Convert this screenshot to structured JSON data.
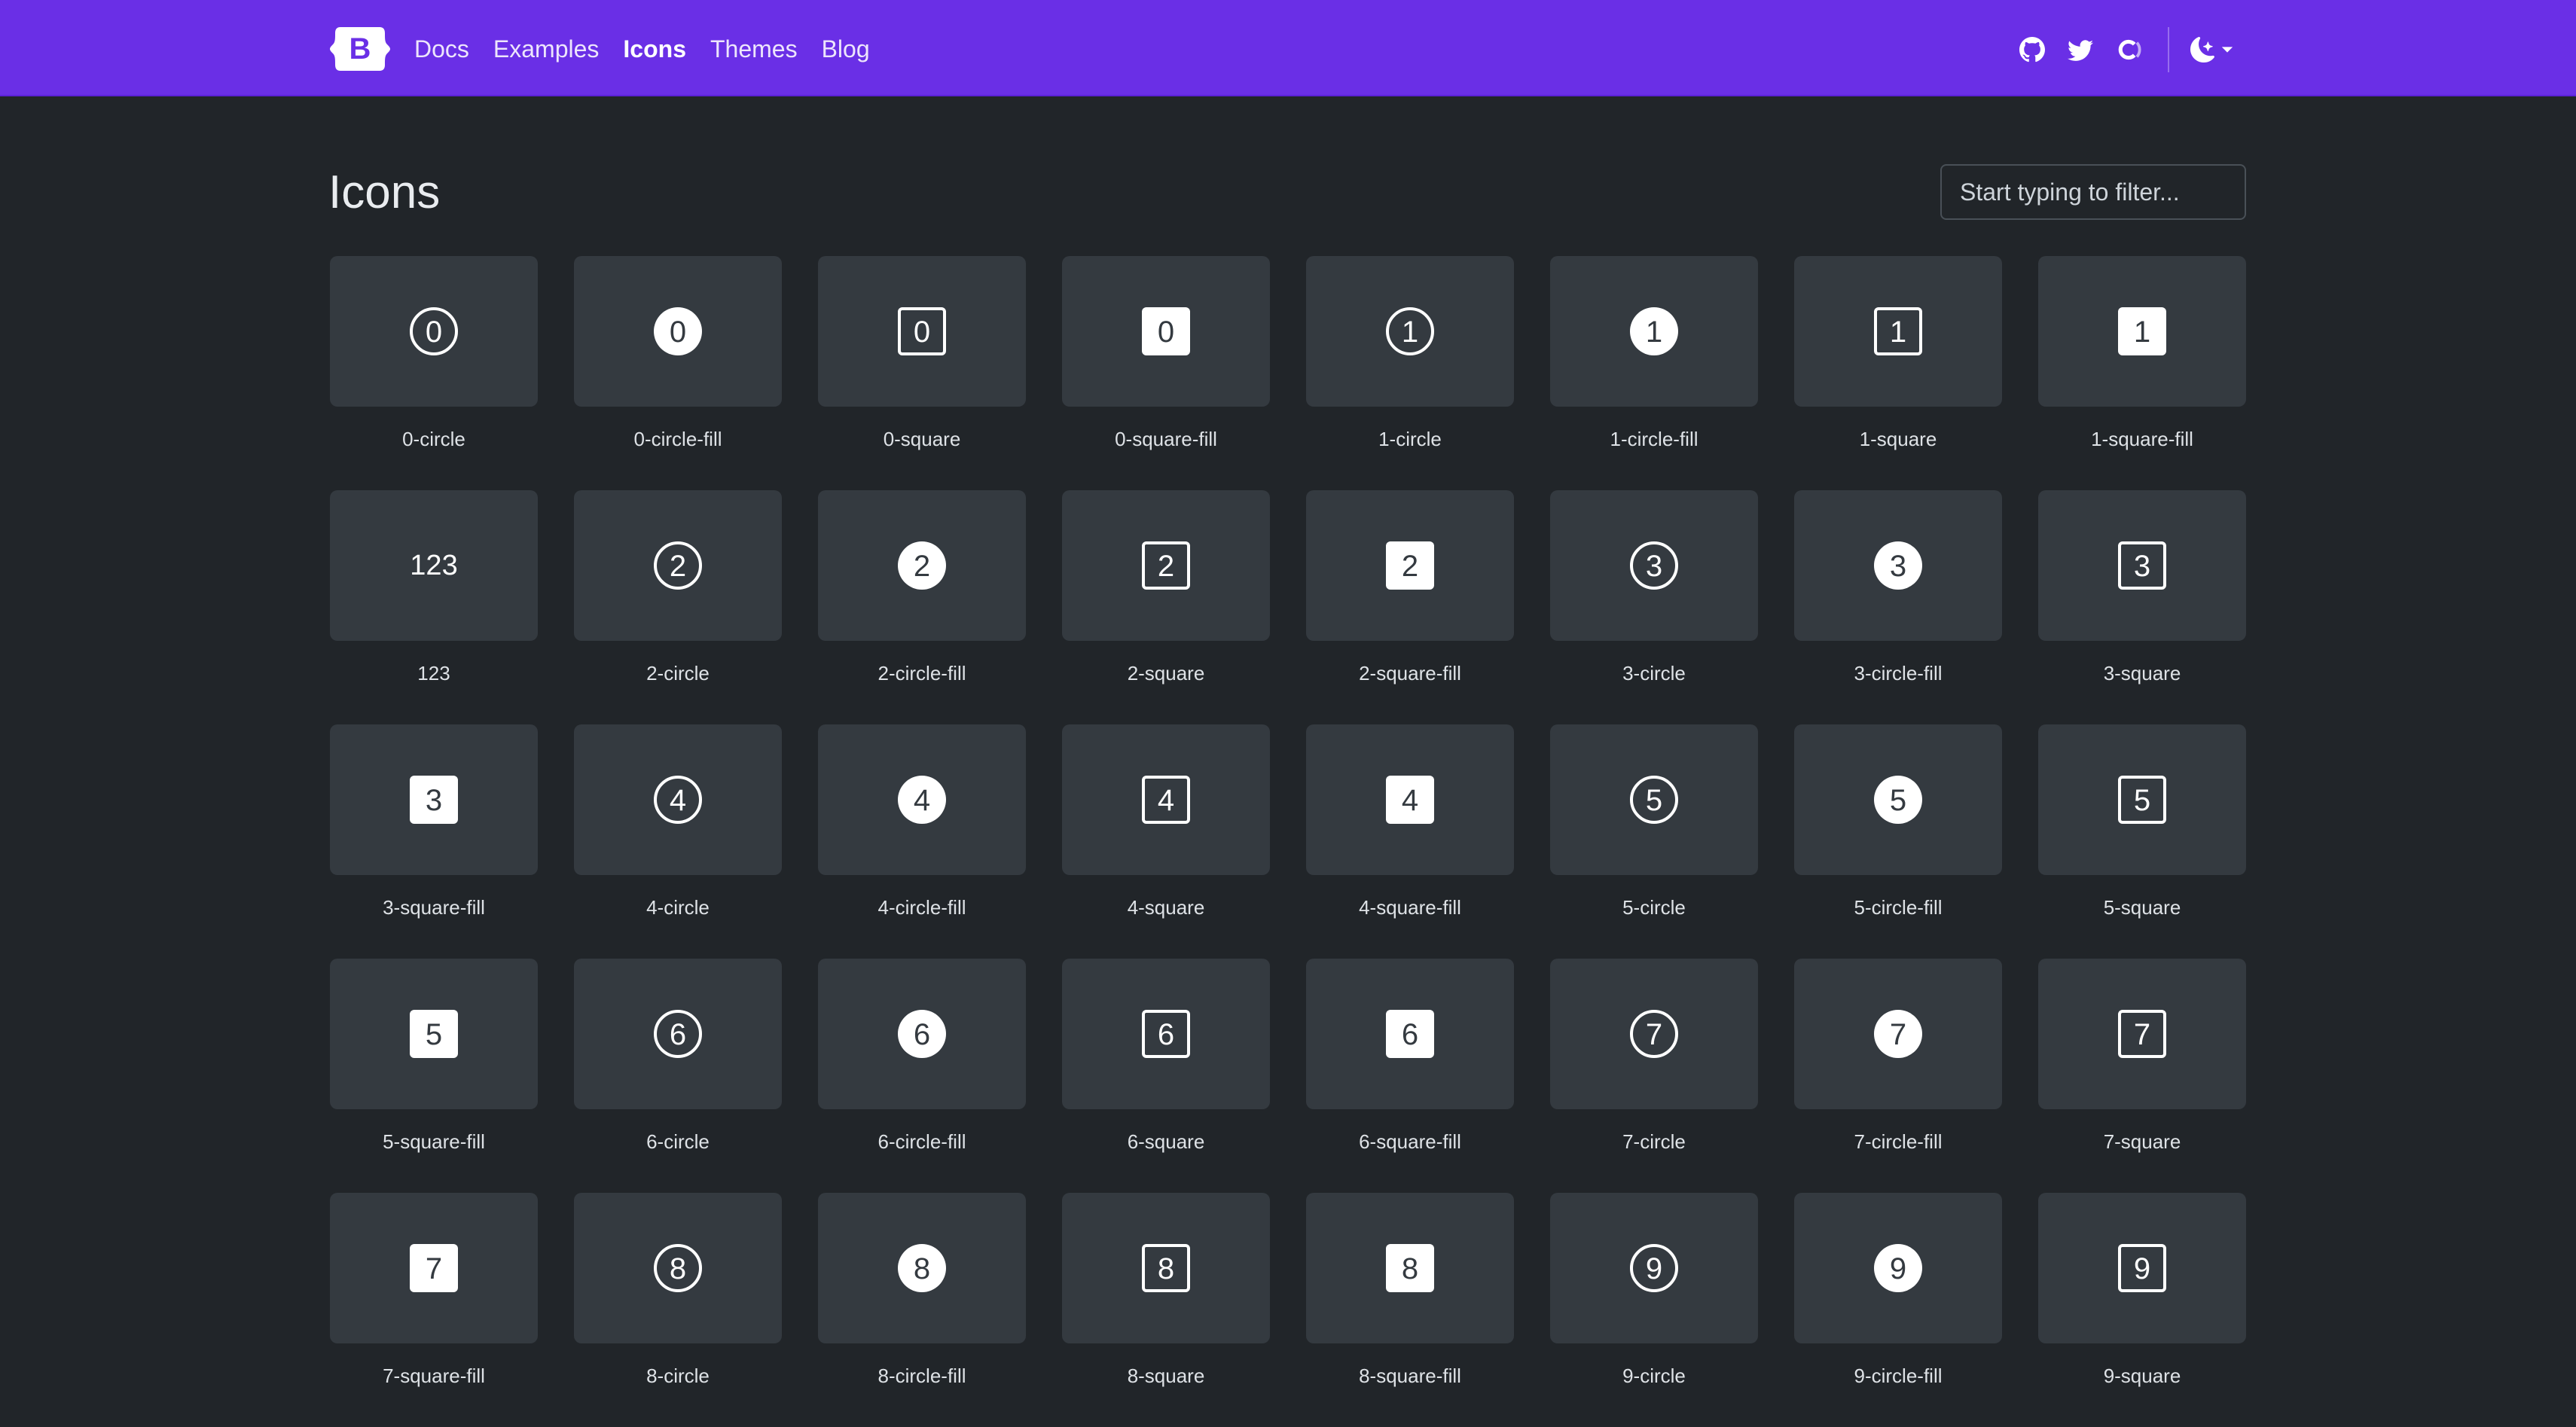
{
  "navbar": {
    "brand_icon": "bootstrap-logo",
    "brand_letter": "B",
    "links": [
      {
        "label": "Docs",
        "active": false
      },
      {
        "label": "Examples",
        "active": false
      },
      {
        "label": "Icons",
        "active": true
      },
      {
        "label": "Themes",
        "active": false
      },
      {
        "label": "Blog",
        "active": false
      }
    ],
    "right_icons": [
      "github-icon",
      "twitter-icon",
      "opencollective-icon"
    ],
    "theme_icon": "moon-stars-icon",
    "color": "#6a2fe6"
  },
  "page": {
    "title": "Icons",
    "filter_placeholder": "Start typing to filter..."
  },
  "icons": [
    {
      "label": "0-circle",
      "digit": "0",
      "style": "circle"
    },
    {
      "label": "0-circle-fill",
      "digit": "0",
      "style": "circle-fill"
    },
    {
      "label": "0-square",
      "digit": "0",
      "style": "square"
    },
    {
      "label": "0-square-fill",
      "digit": "0",
      "style": "square-fill"
    },
    {
      "label": "1-circle",
      "digit": "1",
      "style": "circle"
    },
    {
      "label": "1-circle-fill",
      "digit": "1",
      "style": "circle-fill"
    },
    {
      "label": "1-square",
      "digit": "1",
      "style": "square"
    },
    {
      "label": "1-square-fill",
      "digit": "1",
      "style": "square-fill"
    },
    {
      "label": "123",
      "digit": "123",
      "style": "text"
    },
    {
      "label": "2-circle",
      "digit": "2",
      "style": "circle"
    },
    {
      "label": "2-circle-fill",
      "digit": "2",
      "style": "circle-fill"
    },
    {
      "label": "2-square",
      "digit": "2",
      "style": "square"
    },
    {
      "label": "2-square-fill",
      "digit": "2",
      "style": "square-fill"
    },
    {
      "label": "3-circle",
      "digit": "3",
      "style": "circle"
    },
    {
      "label": "3-circle-fill",
      "digit": "3",
      "style": "circle-fill"
    },
    {
      "label": "3-square",
      "digit": "3",
      "style": "square"
    },
    {
      "label": "3-square-fill",
      "digit": "3",
      "style": "square-fill"
    },
    {
      "label": "4-circle",
      "digit": "4",
      "style": "circle"
    },
    {
      "label": "4-circle-fill",
      "digit": "4",
      "style": "circle-fill"
    },
    {
      "label": "4-square",
      "digit": "4",
      "style": "square"
    },
    {
      "label": "4-square-fill",
      "digit": "4",
      "style": "square-fill"
    },
    {
      "label": "5-circle",
      "digit": "5",
      "style": "circle"
    },
    {
      "label": "5-circle-fill",
      "digit": "5",
      "style": "circle-fill"
    },
    {
      "label": "5-square",
      "digit": "5",
      "style": "square"
    },
    {
      "label": "5-square-fill",
      "digit": "5",
      "style": "square-fill"
    },
    {
      "label": "6-circle",
      "digit": "6",
      "style": "circle"
    },
    {
      "label": "6-circle-fill",
      "digit": "6",
      "style": "circle-fill"
    },
    {
      "label": "6-square",
      "digit": "6",
      "style": "square"
    },
    {
      "label": "6-square-fill",
      "digit": "6",
      "style": "square-fill"
    },
    {
      "label": "7-circle",
      "digit": "7",
      "style": "circle"
    },
    {
      "label": "7-circle-fill",
      "digit": "7",
      "style": "circle-fill"
    },
    {
      "label": "7-square",
      "digit": "7",
      "style": "square"
    },
    {
      "label": "7-square-fill",
      "digit": "7",
      "style": "square-fill"
    },
    {
      "label": "8-circle",
      "digit": "8",
      "style": "circle"
    },
    {
      "label": "8-circle-fill",
      "digit": "8",
      "style": "circle-fill"
    },
    {
      "label": "8-square",
      "digit": "8",
      "style": "square"
    },
    {
      "label": "8-square-fill",
      "digit": "8",
      "style": "square-fill"
    },
    {
      "label": "9-circle",
      "digit": "9",
      "style": "circle"
    },
    {
      "label": "9-circle-fill",
      "digit": "9",
      "style": "circle-fill"
    },
    {
      "label": "9-square",
      "digit": "9",
      "style": "square"
    }
  ]
}
